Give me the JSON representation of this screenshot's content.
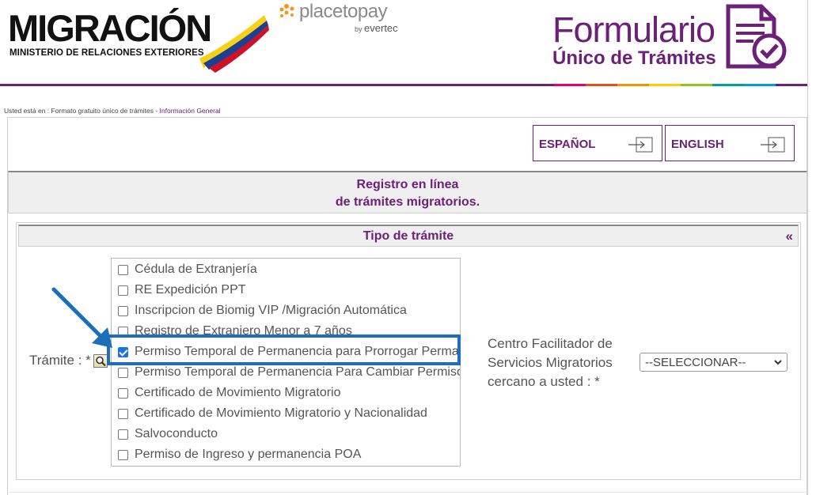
{
  "header": {
    "migracion_logo": {
      "word": "MIGRACIÓN",
      "subtitle": "MINISTERIO DE RELACIONES EXTERIORES"
    },
    "placetopay_logo": {
      "brand": "placetopay",
      "by_prefix": "by",
      "by_brand": "evertec"
    },
    "formulario_logo": {
      "line1": "Formulario",
      "line2": "Único de Trámites"
    },
    "accent_color": "#6d2077",
    "rainbow_colors": [
      "#e6007e",
      "#e94e1b",
      "#f39200",
      "#ffcc00",
      "#95c11f",
      "#00a19a",
      "#009fe3",
      "#6d2077"
    ]
  },
  "breadcrumb": {
    "prefix": "Usted está en : Formato gratuito único de trámites - ",
    "current": "Información General"
  },
  "language": {
    "spanish_label": "ESPAÑOL",
    "english_label": "ENGLISH"
  },
  "registro_title": {
    "line1": "Registro en línea",
    "line2": "de trámites migratorios."
  },
  "tipo_tramite": {
    "title": "Tipo de trámite",
    "collapse_icon": "«",
    "tramite_label": "Trámite : *",
    "search_icon": "magnifier-icon",
    "options": [
      {
        "label": "Cédula de Extranjería",
        "checked": false
      },
      {
        "label": "RE Expedición PPT",
        "checked": false
      },
      {
        "label": "Inscripcion de Biomig VIP /Migración Automática",
        "checked": false
      },
      {
        "label": "Registro de Extranjero Menor a 7 años",
        "checked": false
      },
      {
        "label": "Permiso Temporal de Permanencia para Prorrogar Permanencia",
        "checked": true
      },
      {
        "label": "Permiso Temporal de Permanencia Para Cambiar Permiso",
        "checked": false
      },
      {
        "label": "Certificado de Movimiento Migratorio",
        "checked": false
      },
      {
        "label": "Certificado de Movimiento Migratorio y Nacionalidad",
        "checked": false
      },
      {
        "label": "Salvoconducto",
        "checked": false
      },
      {
        "label": "Permiso de Ingreso y permanencia POA",
        "checked": false
      }
    ],
    "centro_label_lines": [
      "Centro Facilitador de",
      "Servicios Migratorios",
      "cercano a usted : *"
    ],
    "centro_select_value": "--SELECCIONAR--",
    "annotation_color": "#1c6fb8"
  }
}
